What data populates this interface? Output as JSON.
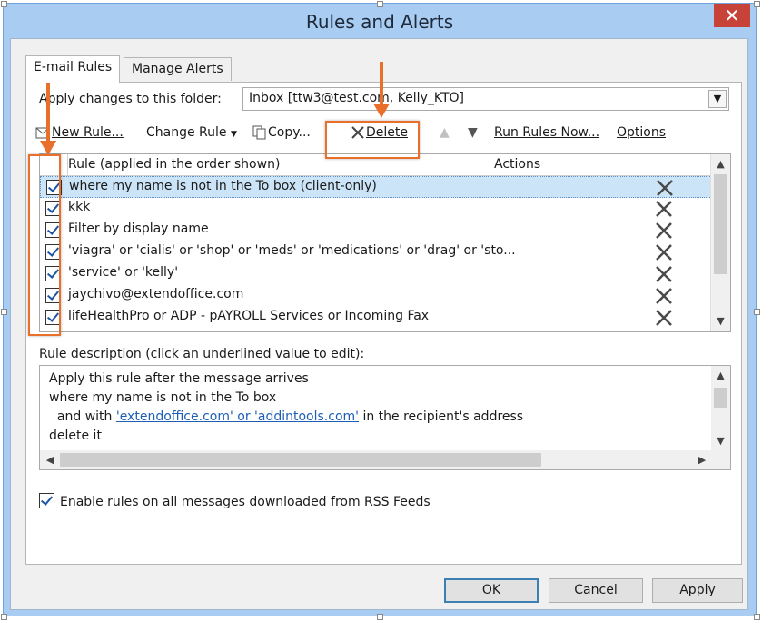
{
  "window": {
    "title": "Rules and Alerts",
    "close_glyph": "✕"
  },
  "tabs": [
    {
      "label": "E-mail Rules",
      "active": true
    },
    {
      "label": "Manage Alerts",
      "active": false
    }
  ],
  "folder": {
    "label": "Apply changes to this folder:",
    "value": "Inbox [ttw3@test.com, Kelly_KTO]"
  },
  "toolbar": {
    "new_rule": "New Rule...",
    "change_rule": "Change Rule",
    "copy": "Copy...",
    "delete": "Delete",
    "run_rules_now": "Run Rules Now...",
    "options": "Options"
  },
  "rules_list": {
    "column_rule": "Rule (applied in the order shown)",
    "column_actions": "Actions",
    "rows": [
      {
        "name": "where my name is not in the To box  (client-only)",
        "checked": true,
        "selected": true,
        "action_icon": "delete-x-icon"
      },
      {
        "name": "kkk",
        "checked": true,
        "selected": false,
        "action_icon": "delete-x-icon"
      },
      {
        "name": "Filter by display name",
        "checked": true,
        "selected": false,
        "action_icon": "delete-x-icon"
      },
      {
        "name": "'viagra' or 'cialis' or 'shop' or 'meds' or 'medications' or 'drag' or 'sto...",
        "checked": true,
        "selected": false,
        "action_icon": "delete-x-icon"
      },
      {
        "name": "'service' or 'kelly'",
        "checked": true,
        "selected": false,
        "action_icon": "delete-x-icon"
      },
      {
        "name": "jaychivo@extendoffice.com",
        "checked": true,
        "selected": false,
        "action_icon": "delete-x-icon"
      },
      {
        "name": "lifeHealthPro or ADP - pAYROLL Services or Incoming Fax",
        "checked": true,
        "selected": false,
        "action_icon": "delete-x-icon"
      }
    ]
  },
  "description": {
    "label": "Rule description (click an underlined value to edit):",
    "line1": "Apply this rule after the message arrives",
    "line2": "where my name is not in the To box",
    "line3_prefix": "  and with ",
    "line3_link": "'extendoffice.com' or 'addintools.com'",
    "line3_suffix": " in the recipient's address",
    "line4": "delete it"
  },
  "rss": {
    "label": "Enable rules on all messages downloaded from RSS Feeds",
    "checked": true
  },
  "buttons": {
    "ok": "OK",
    "cancel": "Cancel",
    "apply": "Apply"
  },
  "colors": {
    "annotation": "#e8702a",
    "link": "#1d5fb5",
    "selection": "#cce4f7",
    "close": "#c7433a"
  }
}
